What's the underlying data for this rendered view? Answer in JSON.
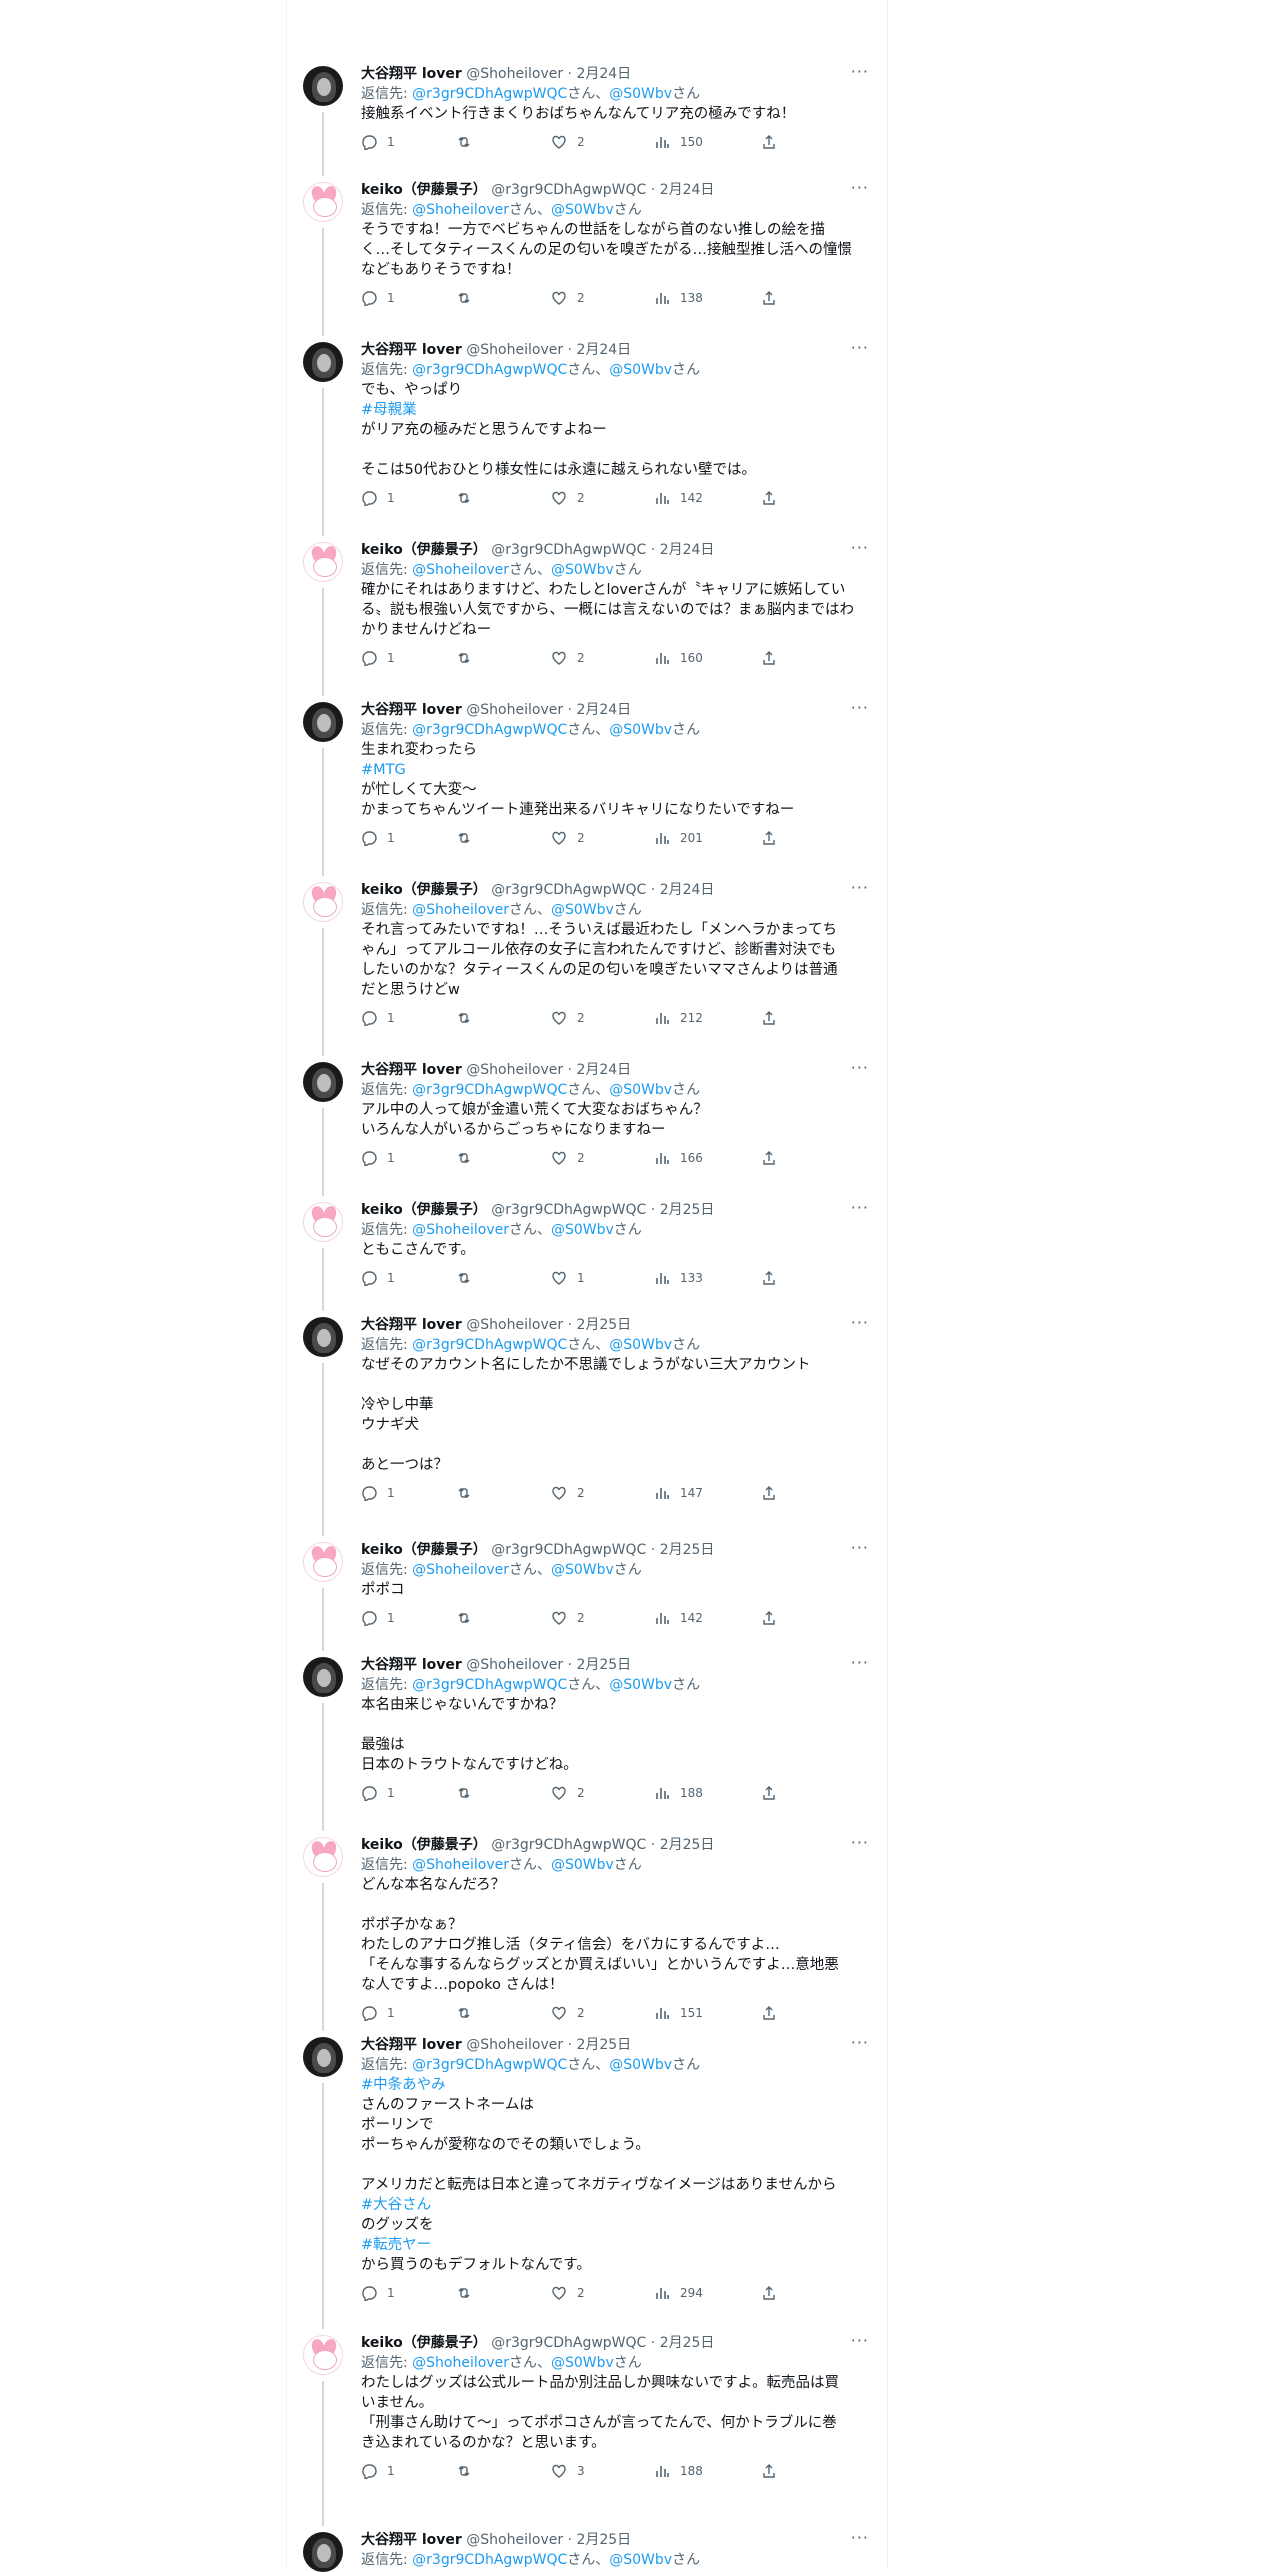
{
  "tweets": [
    {
      "author": "ohtani",
      "name": "大谷翔平 lover",
      "handle": "@Shoheilover",
      "date": "2月24日",
      "reply_handles": [
        "@r3gr9CDhAgwpWQC",
        "@S0Wbv"
      ],
      "lines": [
        {
          "t": "接触系イベント行きまくりおばちゃんなんてリア充の極みですね！"
        }
      ],
      "replies": "1",
      "likes": "2",
      "views": "150"
    },
    {
      "author": "keiko",
      "name": "keiko（伊藤景子）",
      "handle": "@r3gr9CDhAgwpWQC",
      "date": "2月24日",
      "reply_handles": [
        "@Shoheilover",
        "@S0Wbv"
      ],
      "lines": [
        {
          "t": "そうですね！一方でベビちゃんの世話をしながら首のない推しの絵を描"
        },
        {
          "t": "く…そしてタティースくんの足の匂いを嗅ぎたがる…接触型推し活への憧憬"
        },
        {
          "t": "などもありそうですね！"
        }
      ],
      "replies": "1",
      "likes": "2",
      "views": "138"
    },
    {
      "author": "ohtani",
      "name": "大谷翔平 lover",
      "handle": "@Shoheilover",
      "date": "2月24日",
      "reply_handles": [
        "@r3gr9CDhAgwpWQC",
        "@S0Wbv"
      ],
      "lines": [
        {
          "t": "でも、やっぱり"
        },
        {
          "t": "#母親業",
          "tag": true
        },
        {
          "t": "がリア充の極みだと思うんですよねー"
        },
        {
          "t": ""
        },
        {
          "t": "そこは50代おひとり様女性には永遠に越えられない壁では。"
        }
      ],
      "replies": "1",
      "likes": "2",
      "views": "142"
    },
    {
      "author": "keiko",
      "name": "keiko（伊藤景子）",
      "handle": "@r3gr9CDhAgwpWQC",
      "date": "2月24日",
      "reply_handles": [
        "@Shoheilover",
        "@S0Wbv"
      ],
      "lines": [
        {
          "t": "確かにそれはありますけど、わたしとloverさんが〝キャリアに嫉妬してい"
        },
        {
          "t": "る〟説も根強い人気ですから、一概には言えないのでは？まぁ脳内まではわ"
        },
        {
          "t": "かりませんけどねー"
        }
      ],
      "replies": "1",
      "likes": "2",
      "views": "160"
    },
    {
      "author": "ohtani",
      "name": "大谷翔平 lover",
      "handle": "@Shoheilover",
      "date": "2月24日",
      "reply_handles": [
        "@r3gr9CDhAgwpWQC",
        "@S0Wbv"
      ],
      "lines": [
        {
          "t": "生まれ変わったら"
        },
        {
          "t": "#MTG",
          "tag": true
        },
        {
          "t": "が忙しくて大変〜"
        },
        {
          "t": "かまってちゃんツイート連発出来るバリキャリになりたいですねー"
        }
      ],
      "replies": "1",
      "likes": "2",
      "views": "201"
    },
    {
      "author": "keiko",
      "name": "keiko（伊藤景子）",
      "handle": "@r3gr9CDhAgwpWQC",
      "date": "2月24日",
      "reply_handles": [
        "@Shoheilover",
        "@S0Wbv"
      ],
      "lines": [
        {
          "t": "それ言ってみたいですね！…そういえば最近わたし「メンヘラかまってち"
        },
        {
          "t": "ゃん」ってアルコール依存の女子に言われたんですけど、診断書対決でも"
        },
        {
          "t": "したいのかな？タティースくんの足の匂いを嗅ぎたいママさんよりは普通"
        },
        {
          "t": "だと思うけどw"
        }
      ],
      "replies": "1",
      "likes": "2",
      "views": "212"
    },
    {
      "author": "ohtani",
      "name": "大谷翔平 lover",
      "handle": "@Shoheilover",
      "date": "2月24日",
      "reply_handles": [
        "@r3gr9CDhAgwpWQC",
        "@S0Wbv"
      ],
      "lines": [
        {
          "t": "アル中の人って娘が金遣い荒くて大変なおばちゃん？"
        },
        {
          "t": "いろんな人がいるからごっちゃになりますねー"
        }
      ],
      "replies": "1",
      "likes": "2",
      "views": "166"
    },
    {
      "author": "keiko",
      "name": "keiko（伊藤景子）",
      "handle": "@r3gr9CDhAgwpWQC",
      "date": "2月25日",
      "reply_handles": [
        "@Shoheilover",
        "@S0Wbv"
      ],
      "lines": [
        {
          "t": "ともこさんです。"
        }
      ],
      "replies": "1",
      "likes": "1",
      "views": "133"
    },
    {
      "author": "ohtani",
      "name": "大谷翔平 lover",
      "handle": "@Shoheilover",
      "date": "2月25日",
      "reply_handles": [
        "@r3gr9CDhAgwpWQC",
        "@S0Wbv"
      ],
      "lines": [
        {
          "t": "なぜそのアカウント名にしたか不思議でしょうがない三大アカウント"
        },
        {
          "t": ""
        },
        {
          "t": "冷やし中華"
        },
        {
          "t": "ウナギ犬"
        },
        {
          "t": ""
        },
        {
          "t": "あと一つは？"
        }
      ],
      "replies": "1",
      "likes": "2",
      "views": "147"
    },
    {
      "author": "keiko",
      "name": "keiko（伊藤景子）",
      "handle": "@r3gr9CDhAgwpWQC",
      "date": "2月25日",
      "reply_handles": [
        "@Shoheilover",
        "@S0Wbv"
      ],
      "lines": [
        {
          "t": "ポポコ"
        }
      ],
      "replies": "1",
      "likes": "2",
      "views": "142"
    },
    {
      "author": "ohtani",
      "name": "大谷翔平 lover",
      "handle": "@Shoheilover",
      "date": "2月25日",
      "reply_handles": [
        "@r3gr9CDhAgwpWQC",
        "@S0Wbv"
      ],
      "lines": [
        {
          "t": "本名由来じゃないんですかね？"
        },
        {
          "t": ""
        },
        {
          "t": "最強は"
        },
        {
          "t": "日本のトラウトなんですけどね。"
        }
      ],
      "replies": "1",
      "likes": "2",
      "views": "188"
    },
    {
      "author": "keiko",
      "name": "keiko（伊藤景子）",
      "handle": "@r3gr9CDhAgwpWQC",
      "date": "2月25日",
      "reply_handles": [
        "@Shoheilover",
        "@S0Wbv"
      ],
      "lines": [
        {
          "t": "どんな本名なんだろ？"
        },
        {
          "t": ""
        },
        {
          "t": "ポポ子かなぁ？"
        },
        {
          "t": "わたしのアナログ推し活（タティ信会）をバカにするんですよ…"
        },
        {
          "t": "「そんな事するんならグッズとか買えばいい」とかいうんですよ…意地悪"
        },
        {
          "t": "な人ですよ…popoko さんは！"
        }
      ],
      "replies": "1",
      "likes": "2",
      "views": "151"
    },
    {
      "author": "ohtani",
      "name": "大谷翔平 lover",
      "handle": "@Shoheilover",
      "date": "2月25日",
      "reply_handles": [
        "@r3gr9CDhAgwpWQC",
        "@S0Wbv"
      ],
      "lines": [
        {
          "t": "#中条あやみ",
          "tag": true
        },
        {
          "t": "さんのファーストネームは"
        },
        {
          "t": "ポーリンで"
        },
        {
          "t": "ポーちゃんが愛称なのでその類いでしょう。"
        },
        {
          "t": ""
        },
        {
          "t": "アメリカだと転売は日本と違ってネガティヴなイメージはありませんから"
        },
        {
          "t": "#大谷さん",
          "tag": true
        },
        {
          "t": "のグッズを"
        },
        {
          "t": "#転売ヤー",
          "tag": true
        },
        {
          "t": "から買うのもデフォルトなんです。"
        }
      ],
      "replies": "1",
      "likes": "2",
      "views": "294"
    },
    {
      "author": "keiko",
      "name": "keiko（伊藤景子）",
      "handle": "@r3gr9CDhAgwpWQC",
      "date": "2月25日",
      "reply_handles": [
        "@Shoheilover",
        "@S0Wbv"
      ],
      "lines": [
        {
          "t": "わたしはグッズは公式ルート品か別注品しか興味ないですよ。転売品は買"
        },
        {
          "t": "いません。"
        },
        {
          "t": "「刑事さん助けて〜」ってポポコさんが言ってたんで、何かトラブルに巻"
        },
        {
          "t": "き込まれているのかな？と思います。"
        }
      ],
      "replies": "1",
      "likes": "3",
      "views": "188"
    },
    {
      "author": "ohtani",
      "name": "大谷翔平 lover",
      "handle": "@Shoheilover",
      "date": "2月25日",
      "reply_handles": [
        "@r3gr9CDhAgwpWQC",
        "@S0Wbv"
      ],
      "lines": [],
      "replies": "",
      "likes": "",
      "views": ""
    }
  ],
  "labels": {
    "reply_prefix": "返信先: ",
    "san": "さん",
    "comma": "、",
    "dot": "·",
    "more": "···"
  }
}
